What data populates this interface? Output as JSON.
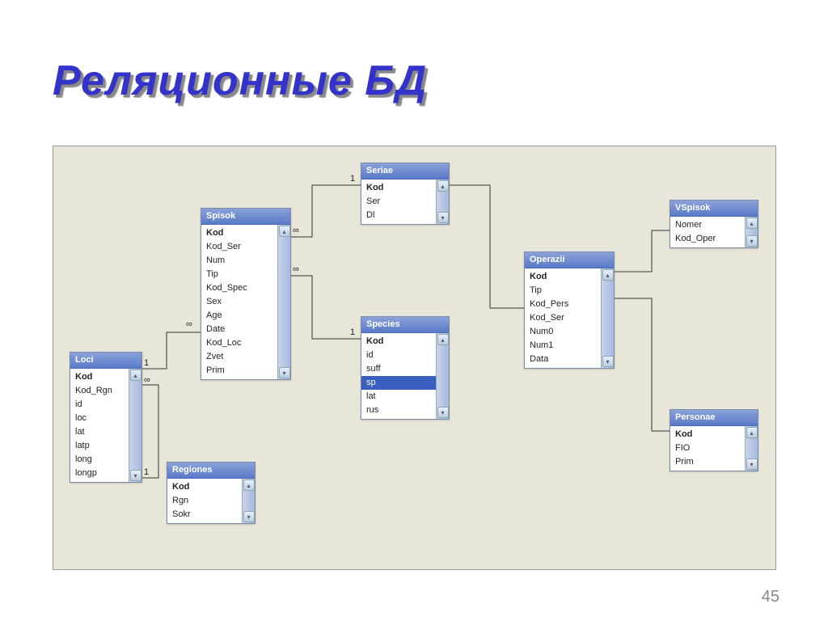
{
  "title": "Реляционные БД",
  "page_number": "45",
  "colors": {
    "accent": "#3333cc",
    "canvas": "#e8e6d8",
    "header_grad_a": "#8aa2d8",
    "header_grad_b": "#5a7ac8"
  },
  "tables": {
    "loci": {
      "title": "Loci",
      "fields": [
        "Kod",
        "Kod_Rgn",
        "id",
        "loc",
        "lat",
        "latp",
        "long",
        "longp"
      ],
      "key_index": 0
    },
    "spisok": {
      "title": "Spisok",
      "fields": [
        "Kod",
        "Kod_Ser",
        "Num",
        "Tip",
        "Kod_Spec",
        "Sex",
        "Age",
        "Date",
        "Kod_Loc",
        "Zvet",
        "Prim"
      ],
      "key_index": 0
    },
    "seriae": {
      "title": "Seriae",
      "fields": [
        "Kod",
        "Ser",
        "Dl"
      ],
      "key_index": 0
    },
    "species": {
      "title": "Species",
      "fields": [
        "Kod",
        "id",
        "suff",
        "sp",
        "lat",
        "rus"
      ],
      "key_index": 0,
      "selected_index": 3
    },
    "regiones": {
      "title": "Regiones",
      "fields": [
        "Kod",
        "Rgn",
        "Sokr"
      ],
      "key_index": 0
    },
    "operazii": {
      "title": "Operazii",
      "fields": [
        "Kod",
        "Tip",
        "Kod_Pers",
        "Kod_Ser",
        "Num0",
        "Num1",
        "Data"
      ],
      "key_index": 0
    },
    "vspisok": {
      "title": "VSpisok",
      "fields": [
        "Nomer",
        "Kod_Oper"
      ]
    },
    "personae": {
      "title": "Personae",
      "fields": [
        "Kod",
        "FIO",
        "Prim"
      ],
      "key_index": 0
    }
  },
  "link_labels": {
    "one": "1",
    "many": "∞"
  },
  "relationships": [
    {
      "from": "Loci.Kod",
      "to": "Spisok.Kod_Loc",
      "type": "1:∞"
    },
    {
      "from": "Regiones.Kod",
      "to": "Loci.Kod_Rgn",
      "type": "1:∞"
    },
    {
      "from": "Seriae.Kod",
      "to": "Spisok.Kod_Ser",
      "type": "1:∞"
    },
    {
      "from": "Species.Kod",
      "to": "Spisok.Kod_Spec",
      "type": "1:∞"
    },
    {
      "from": "Operazii.Kod",
      "to": "VSpisok.Kod_Oper",
      "type": "1:∞"
    },
    {
      "from": "Personae.Kod",
      "to": "Operazii.Kod_Pers",
      "type": "1:∞"
    },
    {
      "from": "Seriae.Kod",
      "to": "Operazii.Kod_Ser",
      "type": "1:∞"
    }
  ]
}
